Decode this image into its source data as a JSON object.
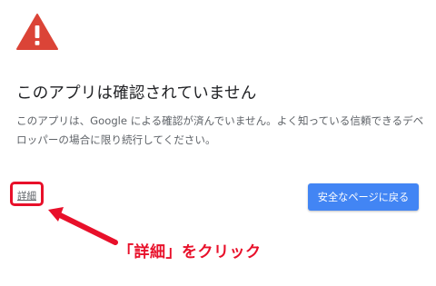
{
  "page": {
    "title": "このアプリは確認されていません",
    "message": "このアプリは、Google による確認が済んでいません。よく知っている信頼できるデベロッパーの場合に限り続行してください。",
    "details_link": "詳細",
    "back_to_safety_button": "安全なページに戻る"
  },
  "annotation": {
    "label": "「詳細」をクリック"
  },
  "icons": {
    "warning": "warning-triangle-icon"
  },
  "colors": {
    "warning_red": "#db4437",
    "button_blue": "#4285f4",
    "annotation_red": "#e8102a",
    "title_text": "#202124",
    "body_text": "#5f6368"
  }
}
